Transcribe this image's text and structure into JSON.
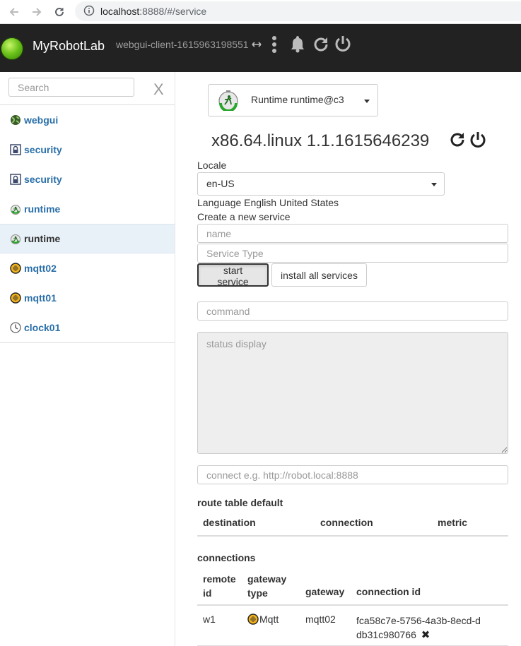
{
  "browser": {
    "url_host": "localhost",
    "url_rest": ":8888/#/service"
  },
  "navbar": {
    "brand": "MyRobotLab",
    "client_id": "webgui-client-1615963198551",
    "icons": [
      "arrows-horizontal-icon",
      "kebab-menu-icon",
      "bell-icon",
      "refresh-icon",
      "power-icon"
    ]
  },
  "sidebar": {
    "search_placeholder": "Search",
    "clear_label": "X",
    "items": [
      {
        "label": "webgui",
        "icon": "globe-icon",
        "active": false
      },
      {
        "label": "security",
        "icon": "lock-icon",
        "active": false
      },
      {
        "label": "security",
        "icon": "lock-icon",
        "active": false
      },
      {
        "label": "runtime",
        "icon": "runtime-icon",
        "active": false
      },
      {
        "label": "runtime",
        "icon": "runtime-icon",
        "active": true
      },
      {
        "label": "mqtt02",
        "icon": "mqtt-icon",
        "active": false
      },
      {
        "label": "mqtt01",
        "icon": "mqtt-icon",
        "active": false
      },
      {
        "label": "clock01",
        "icon": "clock-icon",
        "active": false
      }
    ]
  },
  "main": {
    "runtime_select": "Runtime  runtime@c3",
    "version": "x86.64.linux 1.1.1615646239",
    "locale_label": "Locale",
    "locale_value": "en-US",
    "language_text": "Language English United States",
    "create_label": "Create a new service",
    "name_placeholder": "name",
    "type_placeholder": "Service Type",
    "start_button": "start service",
    "install_button": "install all services",
    "command_placeholder": "command",
    "status_placeholder": "status display",
    "connect_placeholder": "connect e.g. http://robot.local:8888",
    "route_title": "route table default",
    "route_headers": [
      "destination",
      "connection",
      "metric"
    ],
    "connections_title": "connections",
    "conn_headers": [
      "remote id",
      "gateway type",
      "gateway",
      "connection id"
    ],
    "conn_rows": [
      {
        "remote_id": "w1",
        "gateway_type": "Mqtt",
        "gateway": "mqtt02",
        "connection_id": "fca58c7e-5756-4a3b-8ecd-ddb31c980766"
      }
    ],
    "delete_icon": "✖"
  },
  "colors": {
    "navbar": "#222222",
    "link": "#2a6fa8",
    "active_row": "#e8f1f8"
  }
}
